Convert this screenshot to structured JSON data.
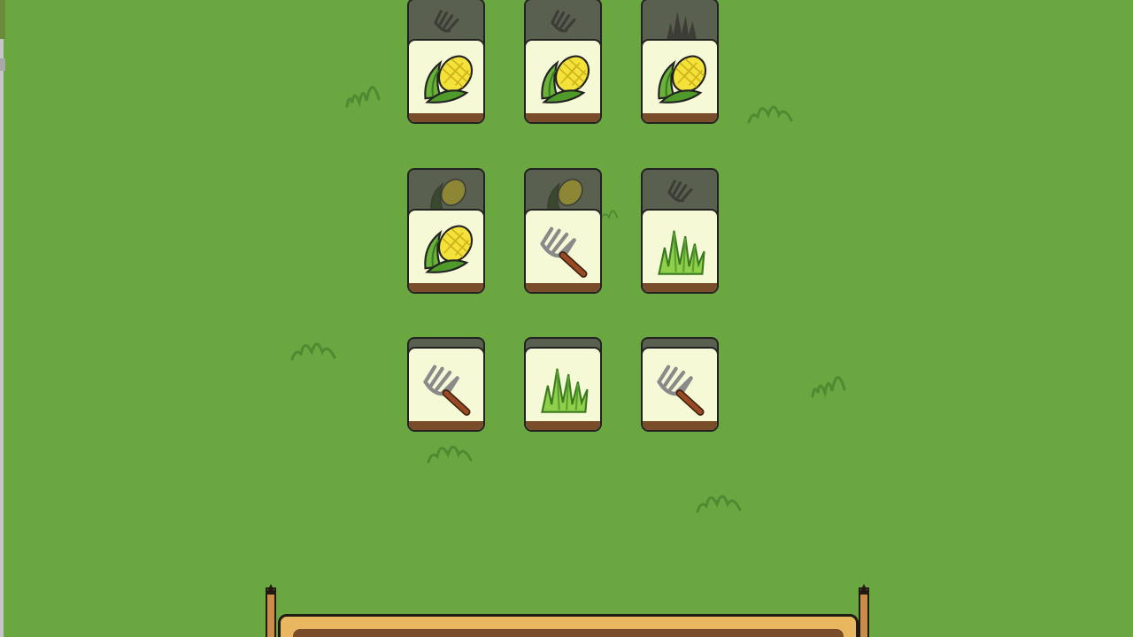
{
  "game": {
    "background_color": "#6aa741",
    "tile_face_color": "#f6f9d6",
    "tile_rim_color": "#7a4d2a",
    "tiles": [
      {
        "row": 1,
        "col": 1,
        "icon": "corn-icon",
        "under_icon": "rake-icon"
      },
      {
        "row": 1,
        "col": 2,
        "icon": "corn-icon",
        "under_icon": "rake-icon"
      },
      {
        "row": 1,
        "col": 3,
        "icon": "corn-icon",
        "under_icon": "grass-icon"
      },
      {
        "row": 2,
        "col": 1,
        "icon": "corn-icon",
        "under_icon": "corn-icon"
      },
      {
        "row": 2,
        "col": 2,
        "icon": "rake-icon",
        "under_icon": "corn-icon"
      },
      {
        "row": 2,
        "col": 3,
        "icon": "grass-icon",
        "under_icon": "rake-icon"
      },
      {
        "row": 3,
        "col": 1,
        "icon": "rake-icon",
        "under_icon": null
      },
      {
        "row": 3,
        "col": 2,
        "icon": "grass-icon",
        "under_icon": null
      },
      {
        "row": 3,
        "col": 3,
        "icon": "rake-icon",
        "under_icon": null
      }
    ],
    "tray": {
      "slots_filled": 0,
      "board_color": "#e8b760"
    }
  }
}
